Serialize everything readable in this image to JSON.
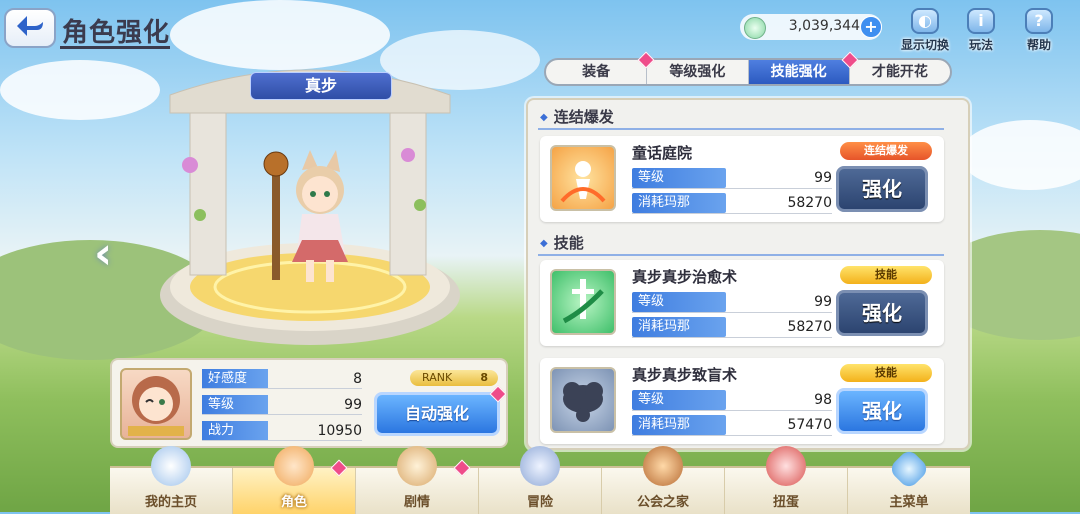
{
  "header": {
    "title": "角色强化"
  },
  "currency": {
    "value": "3,039,344",
    "plus": "+"
  },
  "top_icons": [
    {
      "label": "显示切换",
      "glyph": "◐",
      "icon": "display-switch-icon"
    },
    {
      "label": "玩法",
      "glyph": "i",
      "icon": "info-icon"
    },
    {
      "label": "帮助",
      "glyph": "?",
      "icon": "help-icon"
    }
  ],
  "character": {
    "name": "真步"
  },
  "tabs": [
    {
      "label": "装备",
      "active": false
    },
    {
      "label": "等级强化",
      "active": false
    },
    {
      "label": "技能强化",
      "active": true
    },
    {
      "label": "才能开花",
      "active": false
    }
  ],
  "sections": {
    "union_burst": "连结爆发",
    "skills": "技能"
  },
  "skills": [
    {
      "name": "童话庭院",
      "badge": "连结爆发",
      "level_label": "等级",
      "level": "99",
      "cost_label": "消耗玛那",
      "cost": "58270",
      "button": "强化"
    },
    {
      "name": "真步真步治愈术",
      "badge": "技能",
      "level_label": "等级",
      "level": "99",
      "cost_label": "消耗玛那",
      "cost": "58270",
      "button": "强化"
    },
    {
      "name": "真步真步致盲术",
      "badge": "技能",
      "level_label": "等级",
      "level": "98",
      "cost_label": "消耗玛那",
      "cost": "57470",
      "button": "强化"
    }
  ],
  "char_info": {
    "affection_label": "好感度",
    "affection": "8",
    "level_label": "等级",
    "level": "99",
    "power_label": "战力",
    "power": "10950",
    "rank_label": "RANK",
    "rank": "8",
    "auto_button": "自动强化"
  },
  "nav": [
    {
      "label": "我的主页",
      "icon": "home-icon"
    },
    {
      "label": "角色",
      "icon": "character-icon",
      "active": true
    },
    {
      "label": "剧情",
      "icon": "story-scroll-icon"
    },
    {
      "label": "冒险",
      "icon": "sword-shield-icon"
    },
    {
      "label": "公会之家",
      "icon": "guild-house-icon"
    },
    {
      "label": "扭蛋",
      "icon": "gacha-icon"
    },
    {
      "label": "主菜单",
      "icon": "crystal-icon"
    }
  ],
  "colors": {
    "accent_blue": "#2c5ac0",
    "badge_union": "#e6542a",
    "badge_skill": "#f3b11b",
    "notify": "#ef4c8a"
  }
}
